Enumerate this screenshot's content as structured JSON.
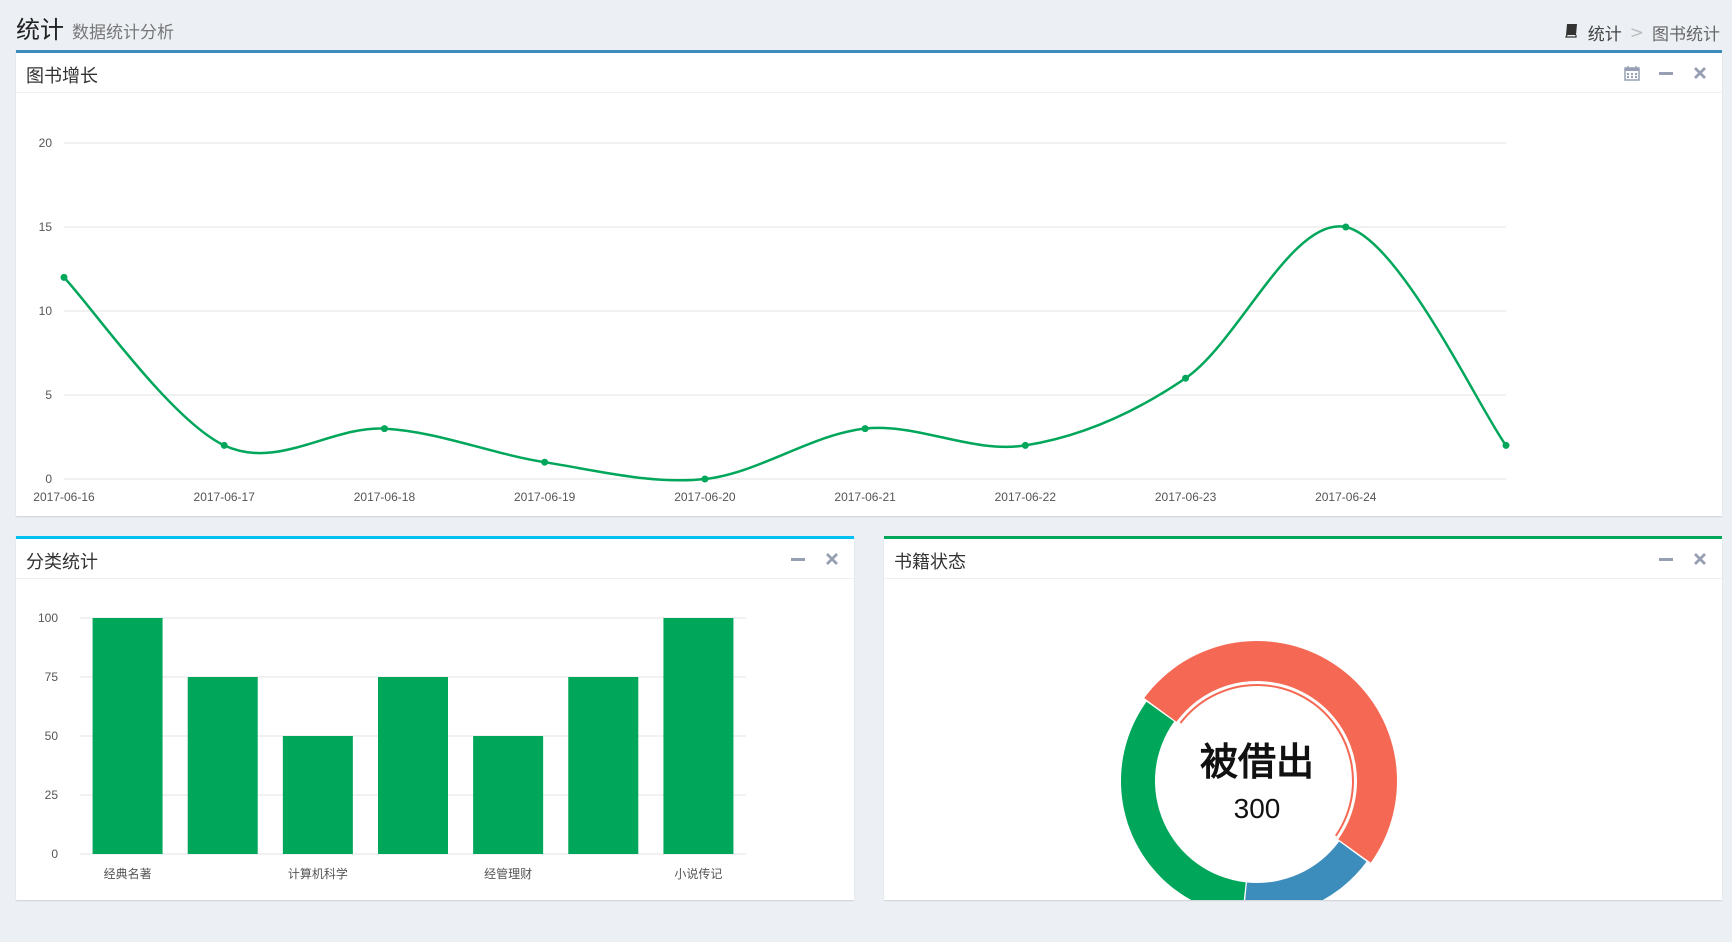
{
  "header": {
    "title": "统计",
    "subtitle": "数据统计分析",
    "breadcrumb": {
      "root": "统计",
      "separator": ">",
      "current": "图书统计"
    }
  },
  "panels": {
    "growth": {
      "title": "图书增长"
    },
    "category": {
      "title": "分类统计"
    },
    "status": {
      "title": "书籍状态"
    }
  },
  "colors": {
    "line": "#00a65a",
    "bar": "#00a65a",
    "donut_red": "#f56954",
    "donut_blue": "#3c8dbc",
    "donut_green": "#00a65a",
    "border_blue": "#3c8dbc",
    "border_aqua": "#00c0ef",
    "border_green": "#00a65a"
  },
  "icons": {
    "calendar": "calendar-icon",
    "minimize": "minus-icon",
    "close": "close-icon",
    "book": "book-icon"
  },
  "chart_data": [
    {
      "type": "line",
      "x": [
        "2017-06-16",
        "2017-06-17",
        "2017-06-18",
        "2017-06-19",
        "2017-06-20",
        "2017-06-21",
        "2017-06-22",
        "2017-06-23",
        "2017-06-24",
        ""
      ],
      "series": [
        {
          "values": [
            12,
            2,
            3,
            1,
            0,
            3,
            2,
            6,
            15,
            2
          ]
        }
      ],
      "yticks": [
        "0",
        "5",
        "10",
        "15",
        "20"
      ],
      "ylim": [
        0,
        20
      ],
      "grid": true
    },
    {
      "type": "bar",
      "categories": [
        "经典名著",
        "",
        "计算机科学",
        "",
        "经管理财",
        "",
        "小说传记"
      ],
      "values": [
        100,
        75,
        50,
        75,
        50,
        75,
        100
      ],
      "yticks": [
        "0",
        "25",
        "50",
        "75",
        "100"
      ],
      "ylim": [
        0,
        100
      ],
      "grid": true
    },
    {
      "type": "pie",
      "style": "donut",
      "slices": [
        {
          "color": "#f56954",
          "value": 300,
          "label": "被借出"
        },
        {
          "color": "#3c8dbc",
          "value": 100
        },
        {
          "color": "#00a65a",
          "value": 200
        }
      ],
      "center_label": "被借出",
      "center_value": "300"
    }
  ]
}
